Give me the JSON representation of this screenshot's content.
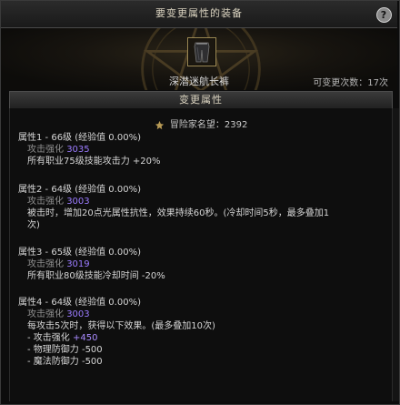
{
  "window": {
    "title": "要变更属性的装备",
    "help_label": "?"
  },
  "item": {
    "name": "深潜迷航长裤",
    "remaining_label": "可变更次数：17次"
  },
  "section": {
    "title": "变更属性"
  },
  "fame": {
    "text": "冒险家名望：2392"
  },
  "attributes": [
    {
      "head": "属性1 - 66级 (经验值 0.00%)",
      "sub_label": "攻击强化",
      "sub_value": "3035",
      "desc": "所有职业75级技能攻击力 +20%"
    },
    {
      "head": "属性2 - 64级 (经验值 0.00%)",
      "sub_label": "攻击强化",
      "sub_value": "3003",
      "desc_line1": "被击时，增加20点光属性抗性，效果持续60秒。(冷却时间5秒，最多叠加1",
      "desc_line2": "次)"
    },
    {
      "head": "属性3 - 65级 (经验值 0.00%)",
      "sub_label": "攻击强化",
      "sub_value": "3019",
      "desc": "所有职业80级技能冷却时间 -20%"
    },
    {
      "head": "属性4 - 64级 (经验值 0.00%)",
      "sub_label": "攻击强化",
      "sub_value": "3003",
      "desc": "每攻击5次时，获得以下效果。(最多叠加10次)",
      "effects": [
        {
          "label": "- 攻击强化 ",
          "value": "+450"
        },
        {
          "label": "- 物理防御力 -500",
          "value": ""
        },
        {
          "label": "- 魔法防御力 -500",
          "value": ""
        }
      ]
    }
  ],
  "colors": {
    "accent_purple": "#9b7bff",
    "title_text": "#d9d2bf"
  }
}
